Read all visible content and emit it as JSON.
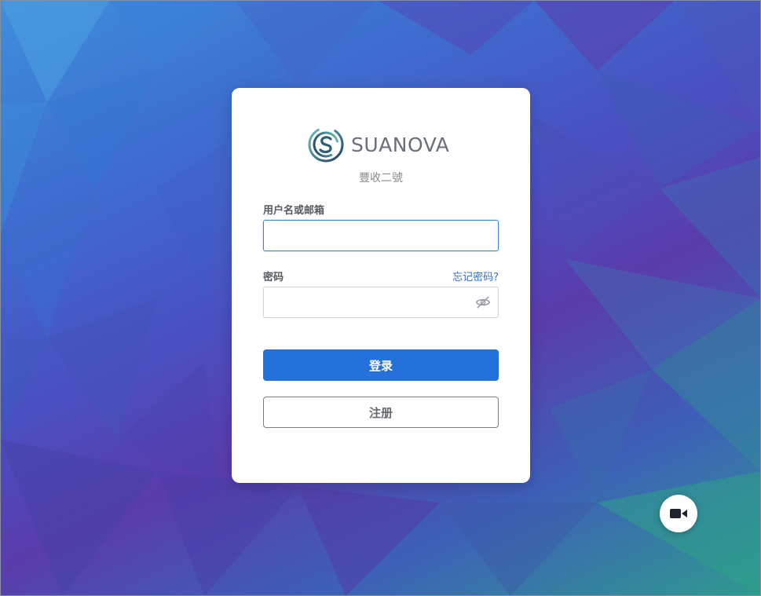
{
  "brand": {
    "name": "SUANOVA",
    "subtitle": "豐收二號",
    "logo_icon": "swirl-s-logo-icon"
  },
  "form": {
    "username_label": "用户名或邮箱",
    "username_value": "",
    "password_label": "密码",
    "password_value": "",
    "forgot_password": "忘记密码?",
    "eye_icon": "eye-slash-icon",
    "login_label": "登录",
    "register_label": "注册"
  },
  "fab": {
    "icon": "video-camera-icon"
  },
  "colors": {
    "primary": "#2571dc",
    "link": "#2c6fd6",
    "focus_border": "#3a86d8"
  }
}
